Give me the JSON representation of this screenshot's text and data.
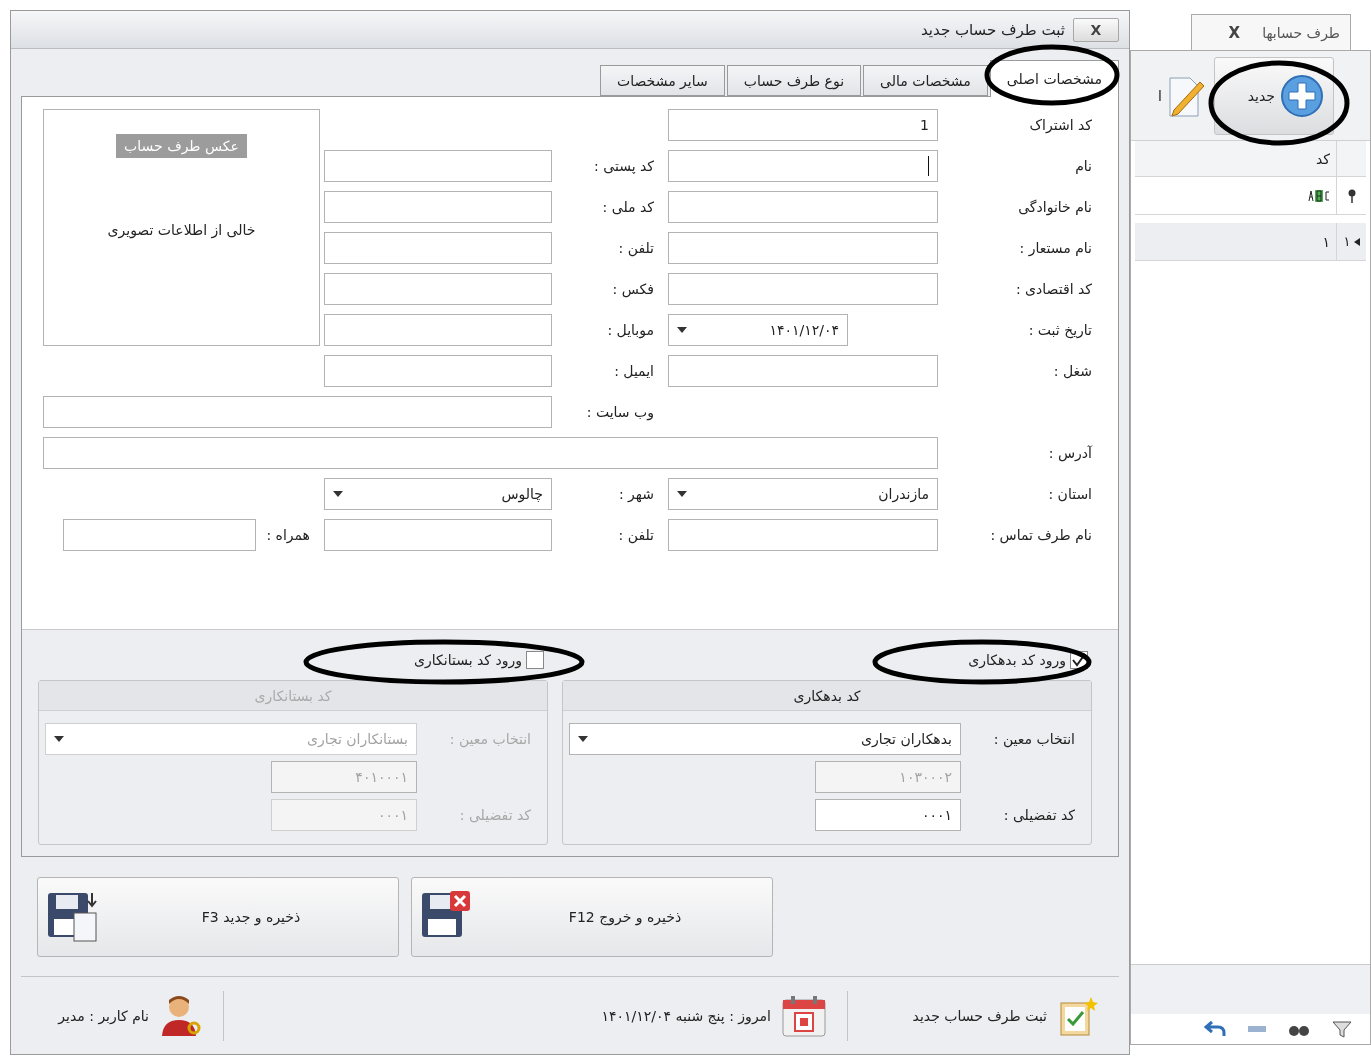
{
  "dialog": {
    "title": "ثبت طرف حساب جدید",
    "close": "X",
    "tabs": [
      {
        "label": "مشخصات اصلی",
        "selected": true
      },
      {
        "label": "مشخصات مالی",
        "selected": false
      },
      {
        "label": "نوع طرف حساب",
        "selected": false
      },
      {
        "label": "سایر مشخصات",
        "selected": false
      }
    ],
    "main_fields": [
      {
        "label": "کد اشتراک",
        "kind": "text",
        "value": "1"
      },
      {
        "label": "نام",
        "kind": "text",
        "focused": true
      },
      {
        "label": "نام خانوادگی",
        "kind": "text"
      },
      {
        "label": "نام مستعار :",
        "kind": "text"
      },
      {
        "label": "کد اقتصادی :",
        "kind": "text"
      },
      {
        "label": "تاریخ ثبت :",
        "kind": "select",
        "value": "۱۴۰۱/۱۲/۰۴"
      },
      {
        "label": "شغل :",
        "kind": "text"
      },
      {
        "label": "آدرس :",
        "kind": "wide"
      },
      {
        "label": "استان :",
        "kind": "select",
        "value": "مازندران"
      },
      {
        "label": "نام طرف تماس :",
        "kind": "text"
      }
    ],
    "side_fields": [
      {
        "label": "کد پستی :",
        "kind": "text"
      },
      {
        "label": "کد ملی :",
        "kind": "text"
      },
      {
        "label": "تلفن :",
        "kind": "text"
      },
      {
        "label": "فکس :",
        "kind": "text"
      },
      {
        "label": "موبایل :",
        "kind": "text"
      },
      {
        "label": "ایمیل :",
        "kind": "text"
      },
      {
        "label": "وب سایت :",
        "kind": "wide"
      },
      {
        "label": "شهر :",
        "kind": "select",
        "value": "چالوس"
      },
      {
        "label": "تلفن :",
        "kind": "text"
      }
    ],
    "extra_field": {
      "label": "همراه :",
      "kind": "text"
    },
    "photo": {
      "button": "عکس طرف حساب",
      "empty_text": "خالی از اطلاعات تصویری"
    },
    "debit": {
      "checked": true,
      "label": "ورود کد بدهکاری",
      "title": "کد بدهکاری",
      "ledger_label": "انتخاب معین :",
      "ledger": "بدهکاران تجاری",
      "ledger_code": "۱۰۳۰۰۰۲",
      "detail_label": "کد تفضیلی :",
      "detail": "۰۰۰۱"
    },
    "credit": {
      "checked": false,
      "label": "ورود کد بستانکاری",
      "title": "کد بستانکاری",
      "ledger_label": "انتخاب معین :",
      "ledger": "بستانکاران تجاری",
      "ledger_code": "۴۰۱۰۰۰۱",
      "detail_label": "کد تفضیلی :",
      "detail": "۰۰۰۱"
    },
    "buttons": [
      {
        "kind": "save_exit",
        "label": "ذخیره و خروج  F12"
      },
      {
        "kind": "save_new",
        "label": "ذخیره و جدید  F3"
      }
    ],
    "status_bar": [
      {
        "kind": "form",
        "text": "ثبت طرف حساب جدید"
      },
      {
        "kind": "date",
        "text": "امروز : پنج شنبه ۱۴۰۱/۱۲/۰۴"
      },
      {
        "kind": "user",
        "text": "نام کاربر : مدیر"
      }
    ]
  },
  "accounts_window": {
    "tab": {
      "label": "طرف حسابها",
      "close": "X"
    },
    "toolbar": [
      {
        "kind": "new",
        "label": "جدید"
      },
      {
        "kind": "edit",
        "label": "ا"
      }
    ],
    "grid": {
      "columns": [
        "کد"
      ],
      "rows": [
        {
          "current": true,
          "row_number": "۱",
          "cells": [
            "۱"
          ]
        }
      ]
    }
  }
}
